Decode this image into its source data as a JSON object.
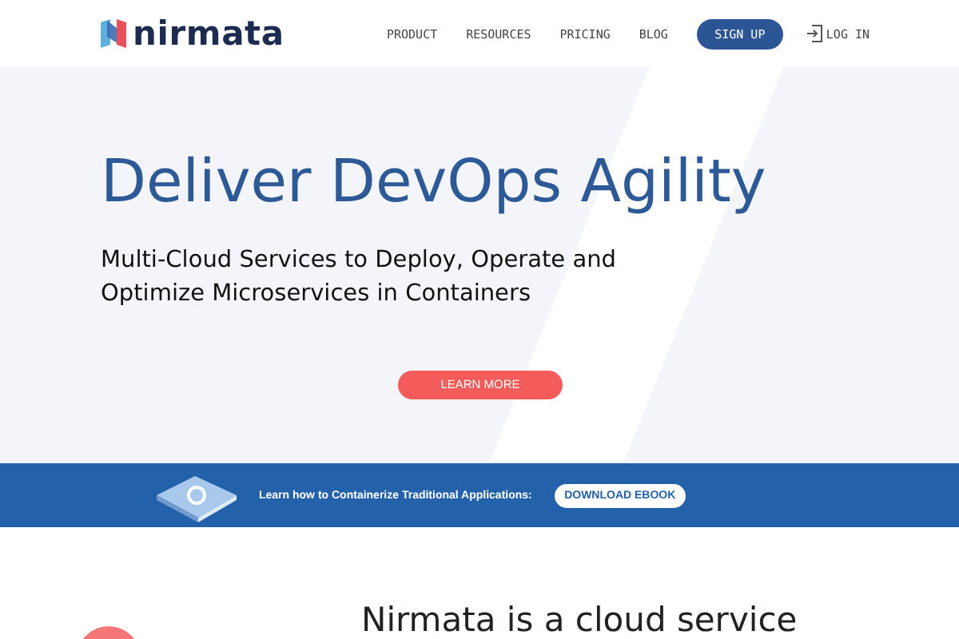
{
  "header": {
    "logo": "nirmata",
    "nav": [
      {
        "label": "PRODUCT"
      },
      {
        "label": "RESOURCES"
      },
      {
        "label": "PRICING"
      },
      {
        "label": "BLOG"
      }
    ],
    "signup": "SIGN UP",
    "login": "LOG IN"
  },
  "hero": {
    "title": "Deliver DevOps Agility",
    "subtitle": "Multi-Cloud Services to Deploy, Operate and Optimize Microservices in Containers",
    "button": "LEARN MORE"
  },
  "banner": {
    "text": "Learn how to Containerize Traditional Applications:",
    "button": "DOWNLOAD EBOOK"
  },
  "intro": {
    "heading": "Nirmata is a cloud service"
  }
}
